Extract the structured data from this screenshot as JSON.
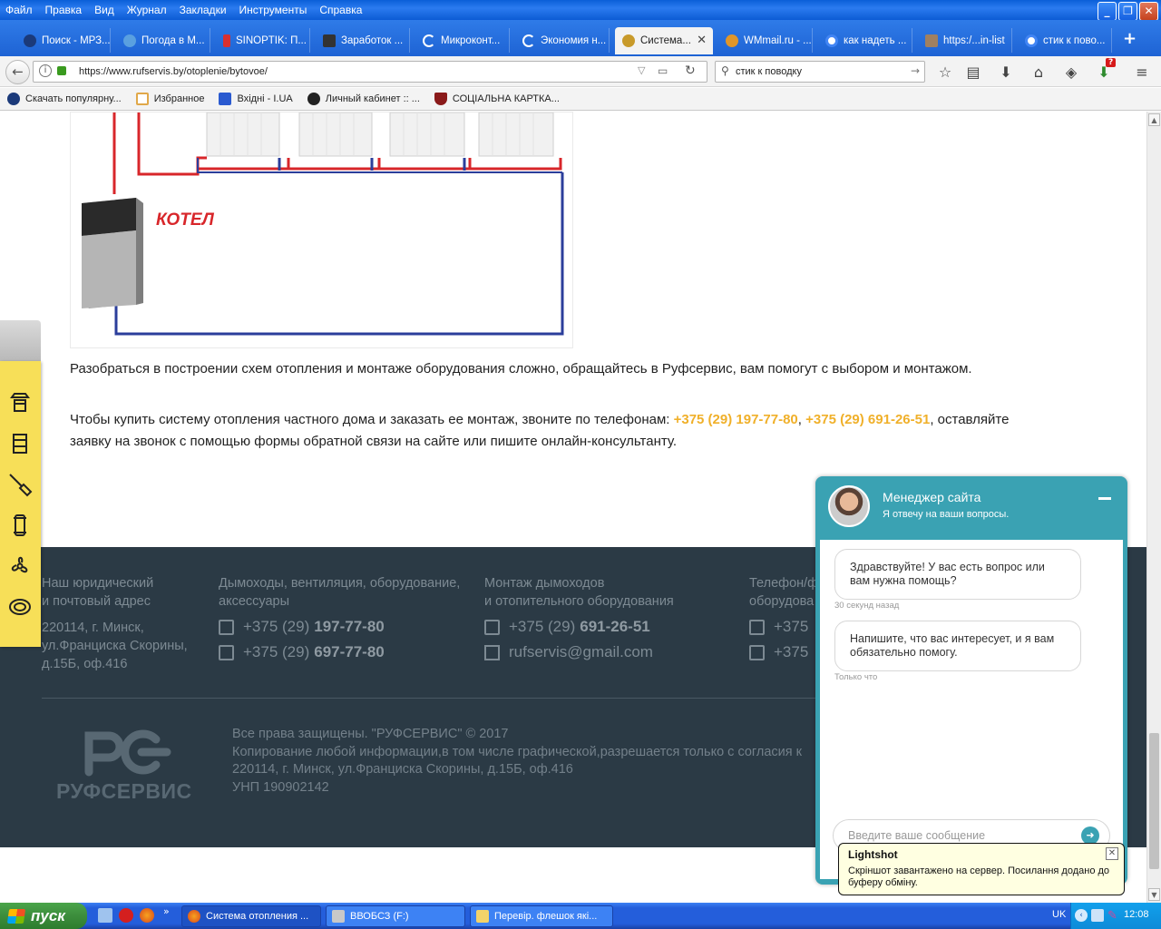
{
  "menubar": [
    "Файл",
    "Правка",
    "Вид",
    "Журнал",
    "Закладки",
    "Инструменты",
    "Справка"
  ],
  "tabs": [
    {
      "label": "Поиск - МРЗ...",
      "color": "#1b3a7a"
    },
    {
      "label": "Погода в М...",
      "color": "#5aa0e0"
    },
    {
      "label": "SINOPTIK: П...",
      "color": "#d83030"
    },
    {
      "label": "Заработок ...",
      "color": "#333333"
    },
    {
      "label": "Микроконт...",
      "color": "#2a6ad0"
    },
    {
      "label": "Экономия н...",
      "color": "#2a6ad0"
    },
    {
      "label": "Система...",
      "color": "#c89a2a",
      "active": true
    },
    {
      "label": "WMmail.ru - ...",
      "color": "#e0962a"
    },
    {
      "label": "как надеть ...",
      "color": "#ffffff"
    },
    {
      "label": "https:/...in-list",
      "color": "#a08060"
    },
    {
      "label": "стик к пово...",
      "color": "#ffffff"
    }
  ],
  "url": "https://www.rufservis.by/otoplenie/bytovoe/",
  "search_value": "стик к поводку",
  "downloads_badge": "?",
  "bookmarks": [
    {
      "label": "Скачать популярну...",
      "color": "#1b3a7a"
    },
    {
      "label": "Избранное",
      "color": "#e0a84a"
    },
    {
      "label": "Вхідні - I.UA",
      "color": "#2a5ad0"
    },
    {
      "label": "Личный кабинет :: ...",
      "color": "#222222"
    },
    {
      "label": "СОЦІАЛЬНА КАРТКА...",
      "color": "#8a1a1a"
    }
  ],
  "scheme": {
    "boiler_label": "КОТЕЛ"
  },
  "content": {
    "para1": "Разобраться в построении схем отопления и монтаже оборудования сложно, обращайтесь в Руфсервис, вам помогут с выбором и монтажом.",
    "para2_pre": "Чтобы купить систему отопления частного дома и заказать ее монтаж, звоните по телефонам: ",
    "phone1": "+375 (29) 197-77-80",
    "sep": ", ",
    "phone2": "+375 (29) 691-26-51",
    "para2_post": ", оставляйте заявку на звонок с помощью формы обратной связи на сайте или пишите онлайн-консультанту."
  },
  "footer": {
    "col1_title_1": "Наш юридический",
    "col1_title_2": "и почтовый адрес",
    "col1_addr_1": "220114, г. Минск,",
    "col1_addr_2": "ул.Франциска Скорины,",
    "col1_addr_3": "д.15Б, оф.416",
    "col2_title_1": "Дымоходы, вентиляция, оборудование,",
    "col2_title_2": "аксессуары",
    "col2_phone1_prefix": "+375 (29)",
    "col2_phone1_num": "197-77-80",
    "col2_phone2_prefix": "+375 (29)",
    "col2_phone2_num": "697-77-80",
    "col3_title_1": "Монтаж дымоходов",
    "col3_title_2": "и отопительного оборудования",
    "col3_phone_prefix": "+375 (29)",
    "col3_phone_num": "691-26-51",
    "col3_email": "rufservis@gmail.com",
    "col4_title_1": "Телефон/ф",
    "col4_title_2": "оборудова",
    "col4_phone1": "+375",
    "col4_phone2": "+375",
    "copy_1": "Все права защищены. \"РУФСЕРВИС\" © 2017",
    "copy_2": "Копирование любой информации,в том числе графической,разрешается только с согласия к",
    "copy_3": "220114, г. Минск, ул.Франциска Скорины, д.15Б, оф.416",
    "copy_4": "УНП 190902142",
    "logo_text": "РУФСЕРВИС"
  },
  "chat": {
    "name": "Менеджер сайта",
    "subtitle": "Я отвечу на ваши вопросы.",
    "messages": [
      {
        "text": "Здравствуйте! У вас есть вопрос или вам нужна помощь?",
        "time": "30 секунд назад"
      },
      {
        "text": "Напишите, что вас интересует, и я вам обязательно помогу.",
        "time": "Только что"
      }
    ],
    "input_placeholder": "Введите ваше сообщение"
  },
  "lightshot": {
    "title": "Lightshot",
    "text": "Скріншот завантажено на сервер. Посилання додано до буферу обміну."
  },
  "taskbar": {
    "start_label": "пуск",
    "tasks": [
      "Система отопления ...",
      "ВВОБСЗ (F:)",
      "Перевір. флешок які..."
    ],
    "lang": "UK",
    "clock": "12:08"
  }
}
